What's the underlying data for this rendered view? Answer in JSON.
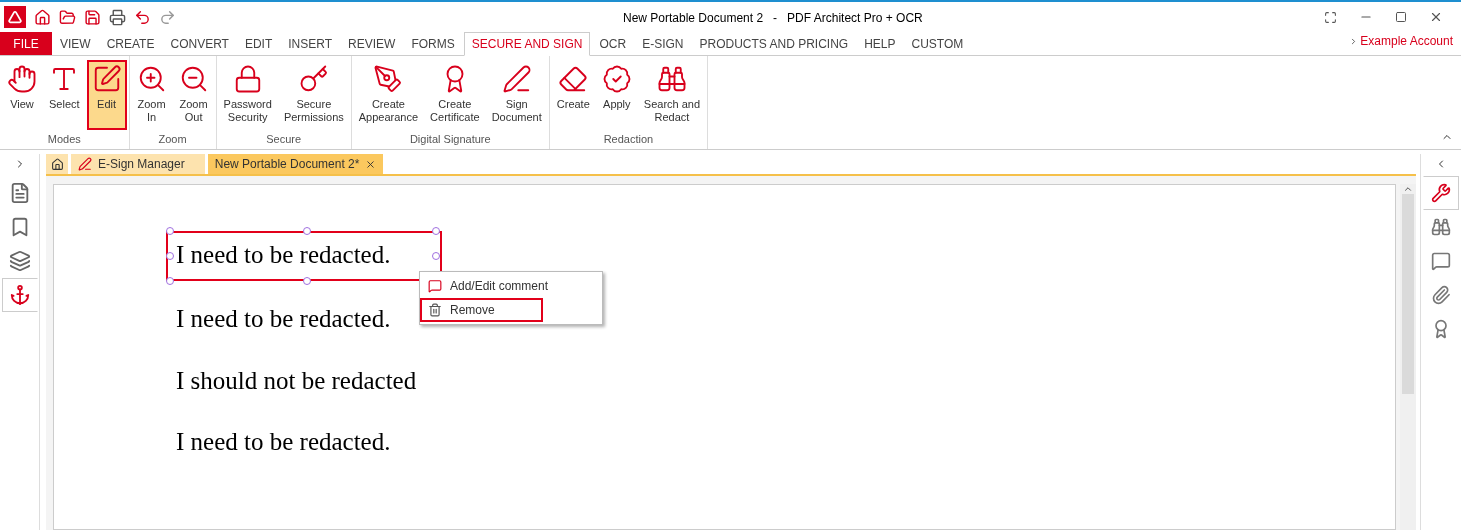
{
  "window": {
    "title": "New Portable Document 2   -   PDF Architect Pro + OCR"
  },
  "menu_tabs": [
    {
      "label": "FILE",
      "kind": "file",
      "selected": false
    },
    {
      "label": "VIEW",
      "kind": "tab",
      "selected": false
    },
    {
      "label": "CREATE",
      "kind": "tab",
      "selected": false
    },
    {
      "label": "CONVERT",
      "kind": "tab",
      "selected": false
    },
    {
      "label": "EDIT",
      "kind": "tab",
      "selected": false
    },
    {
      "label": "INSERT",
      "kind": "tab",
      "selected": false
    },
    {
      "label": "REVIEW",
      "kind": "tab",
      "selected": false
    },
    {
      "label": "FORMS",
      "kind": "tab",
      "selected": false
    },
    {
      "label": "SECURE AND SIGN",
      "kind": "tab",
      "selected": true
    },
    {
      "label": "OCR",
      "kind": "tab",
      "selected": false
    },
    {
      "label": "E-SIGN",
      "kind": "tab",
      "selected": false
    },
    {
      "label": "PRODUCTS AND PRICING",
      "kind": "tab",
      "selected": false
    },
    {
      "label": "HELP",
      "kind": "tab",
      "selected": false
    },
    {
      "label": "CUSTOM",
      "kind": "tab",
      "selected": false
    }
  ],
  "account": "Example Account",
  "ribbon": [
    {
      "label": "Modes",
      "buttons": [
        {
          "label": "View",
          "selected": false
        },
        {
          "label": "Select",
          "selected": false
        },
        {
          "label": "Edit",
          "selected": true
        }
      ]
    },
    {
      "label": "Zoom",
      "buttons": [
        {
          "label": "Zoom\nIn",
          "selected": false
        },
        {
          "label": "Zoom\nOut",
          "selected": false
        }
      ]
    },
    {
      "label": "Secure",
      "buttons": [
        {
          "label": "Password\nSecurity",
          "selected": false
        },
        {
          "label": "Secure\nPermissions",
          "selected": false
        }
      ]
    },
    {
      "label": "Digital Signature",
      "buttons": [
        {
          "label": "Create\nAppearance",
          "selected": false
        },
        {
          "label": "Create\nCertificate",
          "selected": false
        },
        {
          "label": "Sign\nDocument",
          "selected": false
        }
      ]
    },
    {
      "label": "Redaction",
      "buttons": [
        {
          "label": "Create",
          "selected": false
        },
        {
          "label": "Apply",
          "selected": false
        },
        {
          "label": "Search and\nRedact",
          "selected": false
        }
      ]
    }
  ],
  "doc_tabs": [
    {
      "kind": "home",
      "selected": false
    },
    {
      "kind": "tab",
      "label": "E-Sign Manager",
      "selected": false
    },
    {
      "kind": "tab",
      "label": "New Portable Document 2*",
      "selected": true
    }
  ],
  "left_panel": [
    {
      "selected": false
    },
    {
      "selected": false
    },
    {
      "selected": false
    },
    {
      "selected": true
    }
  ],
  "right_panel": [
    {
      "selected": true
    },
    {
      "selected": false
    },
    {
      "selected": false
    },
    {
      "selected": false
    },
    {
      "selected": false
    }
  ],
  "document_lines": [
    {
      "text": "I need to be redacted.",
      "selected": true
    },
    {
      "text": "I need to be redacted.",
      "selected": false
    },
    {
      "text": "I should not be redacted",
      "selected": false
    },
    {
      "text": "I need to be redacted.",
      "selected": false
    }
  ],
  "context_menu": [
    {
      "label": "Add/Edit comment",
      "outlined": false
    },
    {
      "label": "Remove",
      "outlined": true
    }
  ]
}
